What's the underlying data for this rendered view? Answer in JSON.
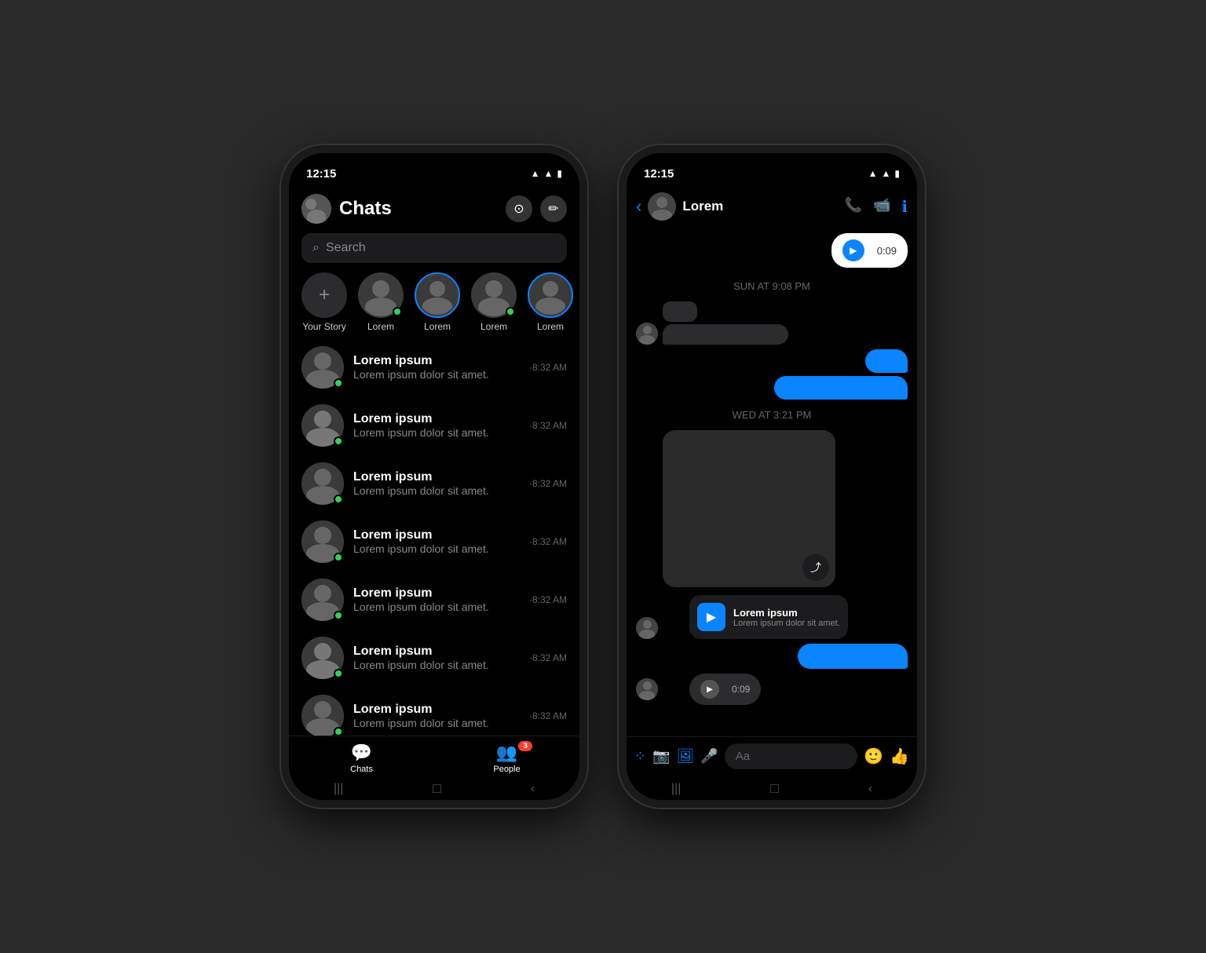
{
  "left_phone": {
    "status_time": "12:15",
    "header_title": "Chats",
    "search_placeholder": "Search",
    "camera_icon": "📷",
    "edit_icon": "✏️",
    "stories": [
      {
        "label": "Your Story",
        "type": "add"
      },
      {
        "label": "Lorem",
        "type": "normal",
        "online": true
      },
      {
        "label": "Lorem",
        "type": "ring"
      },
      {
        "label": "Lorem",
        "type": "normal",
        "online": true
      },
      {
        "label": "Lorem",
        "type": "ring"
      }
    ],
    "chats": [
      {
        "name": "Lorem ipsum",
        "preview": "Lorem ipsum dolor sit amet.",
        "time": "·8:32 AM"
      },
      {
        "name": "Lorem ipsum",
        "preview": "Lorem ipsum dolor sit amet.",
        "time": "·8:32 AM"
      },
      {
        "name": "Lorem ipsum",
        "preview": "Lorem ipsum dolor sit amet.",
        "time": "·8:32 AM"
      },
      {
        "name": "Lorem ipsum",
        "preview": "Lorem ipsum dolor sit amet.",
        "time": "·8:32 AM"
      },
      {
        "name": "Lorem ipsum",
        "preview": "Lorem ipsum dolor sit amet.",
        "time": "·8:32 AM"
      },
      {
        "name": "Lorem ipsum",
        "preview": "Lorem ipsum dolor sit amet.",
        "time": "·8:32 AM"
      },
      {
        "name": "Lorem ipsum",
        "preview": "Lorem ipsum dolor sit amet.",
        "time": "·8:32 AM"
      }
    ],
    "nav": {
      "chats_label": "Chats",
      "people_label": "People",
      "people_badge": "3"
    }
  },
  "right_phone": {
    "status_time": "12:15",
    "contact_name": "Lorem",
    "date1": "SUN AT 9:08 PM",
    "date2": "WED AT 3:21 PM",
    "audio_duration": "0:09",
    "audio_duration2": "0:09",
    "link_title": "Lorem ipsum",
    "link_desc": "Lorem ipsum dolor sit amet.",
    "input_placeholder": "Aa"
  }
}
